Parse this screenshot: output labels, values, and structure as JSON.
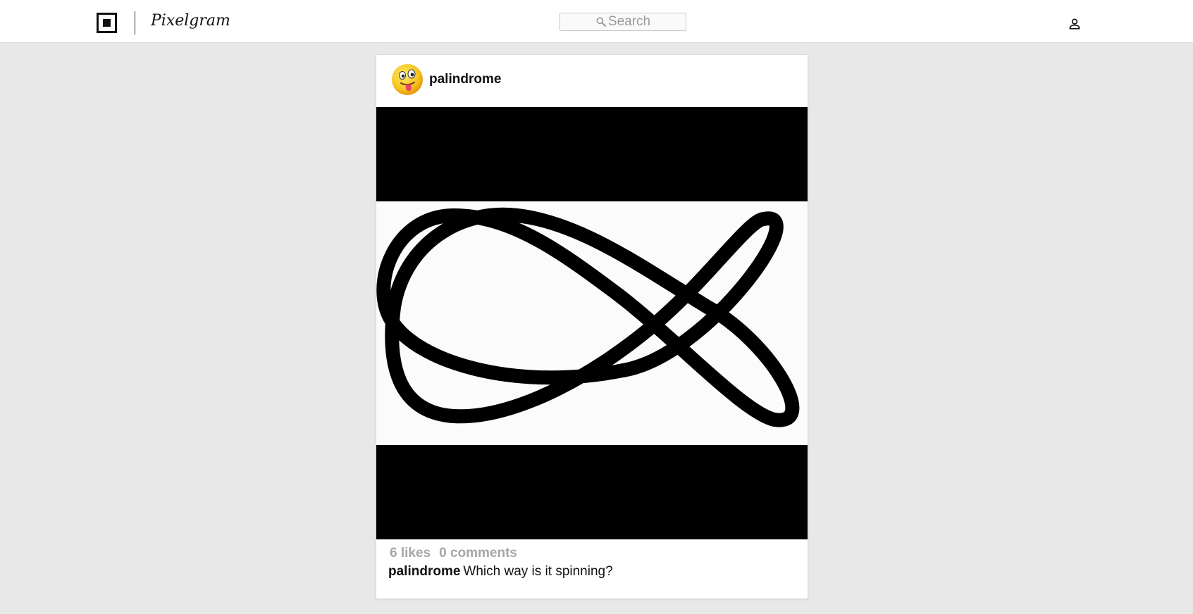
{
  "header": {
    "brand": "Pixelgram",
    "search_placeholder": "Search",
    "icons": {
      "logo": "logo-square-icon",
      "search": "search-icon",
      "profile": "person-icon"
    }
  },
  "post": {
    "username": "palindrome",
    "avatar": "winking-tongue-emoji",
    "likes": "6 likes",
    "comments": "0 comments",
    "caption_user": "palindrome",
    "caption_text": "Which way is it spinning?"
  },
  "colors": {
    "background": "#e8e8e8",
    "card": "#ffffff",
    "muted_text": "#a6a6a6",
    "image_letterbox": "#000000"
  }
}
